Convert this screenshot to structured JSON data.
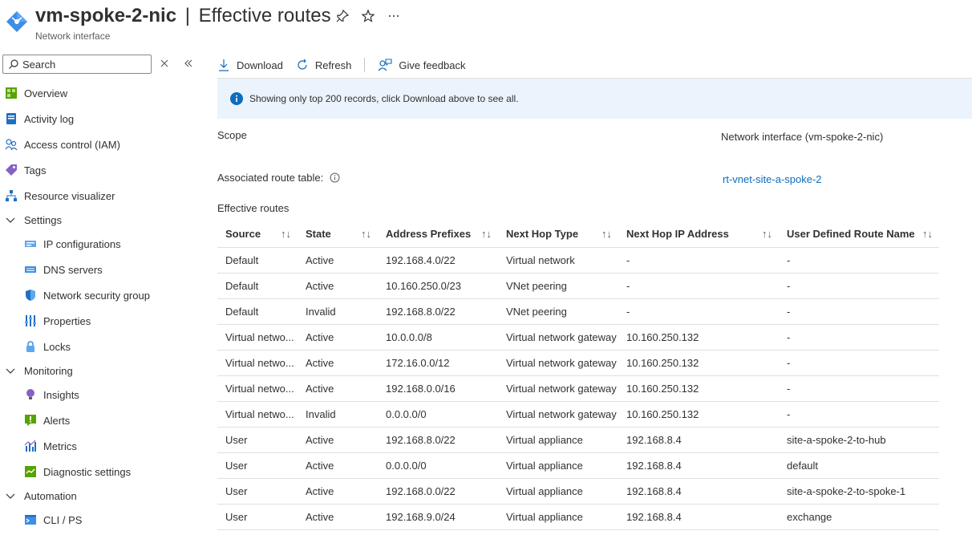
{
  "header": {
    "resource_name": "vm-spoke-2-nic",
    "separator": "|",
    "page_title": "Effective routes",
    "subtitle": "Network interface"
  },
  "sidebar": {
    "search_placeholder": "Search",
    "items": [
      {
        "label": "Overview",
        "icon": "overview-icon",
        "type": "item"
      },
      {
        "label": "Activity log",
        "icon": "activity-log-icon",
        "type": "item"
      },
      {
        "label": "Access control (IAM)",
        "icon": "iam-icon",
        "type": "item"
      },
      {
        "label": "Tags",
        "icon": "tag-icon",
        "type": "item"
      },
      {
        "label": "Resource visualizer",
        "icon": "visualizer-icon",
        "type": "item"
      },
      {
        "label": "Settings",
        "icon": "chevron-down-icon",
        "type": "group"
      },
      {
        "label": "IP configurations",
        "icon": "ip-config-icon",
        "type": "sub"
      },
      {
        "label": "DNS servers",
        "icon": "dns-icon",
        "type": "sub"
      },
      {
        "label": "Network security group",
        "icon": "shield-icon",
        "type": "sub"
      },
      {
        "label": "Properties",
        "icon": "properties-icon",
        "type": "sub"
      },
      {
        "label": "Locks",
        "icon": "lock-icon",
        "type": "sub"
      },
      {
        "label": "Monitoring",
        "icon": "chevron-down-icon",
        "type": "group"
      },
      {
        "label": "Insights",
        "icon": "lightbulb-icon",
        "type": "sub"
      },
      {
        "label": "Alerts",
        "icon": "alert-icon",
        "type": "sub"
      },
      {
        "label": "Metrics",
        "icon": "metrics-icon",
        "type": "sub"
      },
      {
        "label": "Diagnostic settings",
        "icon": "diagnostic-icon",
        "type": "sub"
      },
      {
        "label": "Automation",
        "icon": "chevron-down-icon",
        "type": "group"
      },
      {
        "label": "CLI / PS",
        "icon": "terminal-icon",
        "type": "sub"
      }
    ]
  },
  "toolbar": {
    "download_label": "Download",
    "refresh_label": "Refresh",
    "feedback_label": "Give feedback"
  },
  "info_message": "Showing only top 200 records, click Download above to see all.",
  "scope": {
    "label": "Scope",
    "value": "Network interface (vm-spoke-2-nic)"
  },
  "associated_route_table": {
    "label": "Associated route table:",
    "value": "rt-vnet-site-a-spoke-2"
  },
  "effective_routes_label": "Effective routes",
  "table": {
    "columns": [
      "Source",
      "State",
      "Address Prefixes",
      "Next Hop Type",
      "Next Hop IP Address",
      "User Defined Route Name"
    ],
    "rows": [
      [
        "Default",
        "Active",
        "192.168.4.0/22",
        "Virtual network",
        "-",
        "-"
      ],
      [
        "Default",
        "Active",
        "10.160.250.0/23",
        "VNet peering",
        "-",
        "-"
      ],
      [
        "Default",
        "Invalid",
        "192.168.8.0/22",
        "VNet peering",
        "-",
        "-"
      ],
      [
        "Virtual netwo...",
        "Active",
        "10.0.0.0/8",
        "Virtual network gateway",
        "10.160.250.132",
        "-"
      ],
      [
        "Virtual netwo...",
        "Active",
        "172.16.0.0/12",
        "Virtual network gateway",
        "10.160.250.132",
        "-"
      ],
      [
        "Virtual netwo...",
        "Active",
        "192.168.0.0/16",
        "Virtual network gateway",
        "10.160.250.132",
        "-"
      ],
      [
        "Virtual netwo...",
        "Invalid",
        "0.0.0.0/0",
        "Virtual network gateway",
        "10.160.250.132",
        "-"
      ],
      [
        "User",
        "Active",
        "192.168.8.0/22",
        "Virtual appliance",
        "192.168.8.4",
        "site-a-spoke-2-to-hub"
      ],
      [
        "User",
        "Active",
        "0.0.0.0/0",
        "Virtual appliance",
        "192.168.8.4",
        "default"
      ],
      [
        "User",
        "Active",
        "192.168.0.0/22",
        "Virtual appliance",
        "192.168.8.4",
        "site-a-spoke-2-to-spoke-1"
      ],
      [
        "User",
        "Active",
        "192.168.9.0/24",
        "Virtual appliance",
        "192.168.8.4",
        "exchange"
      ]
    ]
  },
  "colors": {
    "accent": "#0f6cbd",
    "info_bg": "#ebf3fc",
    "border": "#e1dfdd"
  }
}
